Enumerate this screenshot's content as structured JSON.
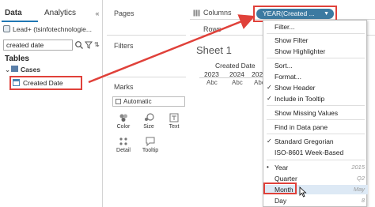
{
  "left_pane": {
    "tabs": [
      "Data",
      "Analytics"
    ],
    "collapse_glyph": "«",
    "datasource": "Lead+ (tsinfotechnologie...",
    "search": {
      "value": "created date",
      "placeholder": ""
    },
    "sort_glyph": "⇅",
    "tables_heading": "Tables",
    "table_name": "Cases",
    "field_name": "Created Date"
  },
  "cards": {
    "pages": "Pages",
    "filters": "Filters",
    "marks": "Marks",
    "mark_type": "Automatic",
    "buttons": [
      "Color",
      "Size",
      "Text",
      "Detail",
      "Tooltip"
    ]
  },
  "shelves": {
    "columns": "Columns",
    "rows": "Rows",
    "pill": "YEAR(Created ..."
  },
  "view": {
    "sheet_title": "Sheet 1",
    "header": "Created Date",
    "years": [
      "2023",
      "2024",
      "2025"
    ],
    "placeholder": "Abc"
  },
  "context_menu": {
    "items": [
      {
        "label": "Filter...",
        "check": "",
        "hint": ""
      },
      {
        "label": "Show Filter",
        "check": "",
        "hint": ""
      },
      {
        "label": "Show Highlighter",
        "check": "",
        "hint": ""
      },
      {
        "label": "Sort...",
        "check": "",
        "hint": ""
      },
      {
        "label": "Format...",
        "check": "",
        "hint": ""
      },
      {
        "label": "Show Header",
        "check": "✓",
        "hint": ""
      },
      {
        "label": "Include in Tooltip",
        "check": "✓",
        "hint": ""
      },
      {
        "label": "Show Missing Values",
        "check": "",
        "hint": ""
      },
      {
        "label": "Find in Data pane",
        "check": "",
        "hint": ""
      },
      {
        "label": "Standard Gregorian",
        "check": "✓",
        "hint": ""
      },
      {
        "label": "ISO-8601 Week-Based",
        "check": "",
        "hint": ""
      },
      {
        "label": "Year",
        "check": "•",
        "hint": "2015"
      },
      {
        "label": "Quarter",
        "check": "",
        "hint": "Q2"
      },
      {
        "label": "Month",
        "check": "",
        "hint": "May"
      },
      {
        "label": "Day",
        "check": "",
        "hint": "8"
      }
    ]
  },
  "colors": {
    "pill": "#3c7aa1",
    "highlight_box": "#e0413a",
    "tab_underline": "#1f77b4"
  }
}
